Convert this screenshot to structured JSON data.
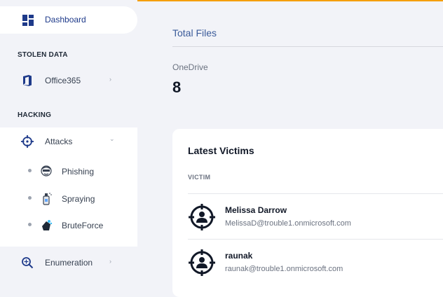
{
  "sidebar": {
    "dashboard": {
      "label": "Dashboard",
      "icon": "dashboard-icon"
    },
    "sections": [
      "STOLEN DATA",
      "HACKING"
    ],
    "office365": {
      "label": "Office365",
      "icon": "office-icon",
      "chevron": "›"
    },
    "attacks": {
      "label": "Attacks",
      "icon": "crosshair-icon",
      "chevron": "⌄",
      "children": [
        {
          "label": "Phishing",
          "icon": "phishing-icon"
        },
        {
          "label": "Spraying",
          "icon": "spray-can-icon"
        },
        {
          "label": "BruteForce",
          "icon": "bruteforce-icon"
        }
      ]
    },
    "enumeration": {
      "label": "Enumeration",
      "icon": "magnifier-icon",
      "chevron": "›"
    }
  },
  "main": {
    "total_files": {
      "title": "Total Files",
      "items": [
        {
          "label": "OneDrive",
          "count": "8"
        }
      ]
    },
    "latest_victims": {
      "title": "Latest Victims",
      "column_header": "VICTIM",
      "rows": [
        {
          "name": "Melissa Darrow",
          "email": "MelissaD@trouble1.onmicrosoft.com",
          "icon": "victim-target-icon"
        },
        {
          "name": "raunak",
          "email": "raunak@trouble1.onmicrosoft.com",
          "icon": "victim-target-icon"
        }
      ]
    }
  },
  "colors": {
    "accent_top": "#f59e0b",
    "nav_blue": "#1e3a8a",
    "background": "#f2f3f8"
  }
}
